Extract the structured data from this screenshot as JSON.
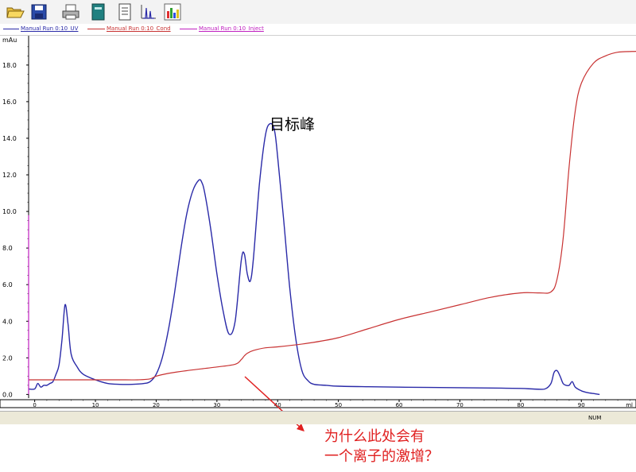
{
  "toolbar": {
    "icons": [
      "open-folder-icon",
      "save-icon",
      "print-icon",
      "notebook-icon",
      "document-icon",
      "peak-chromatogram-icon",
      "bar-chart-icon"
    ]
  },
  "legend": {
    "items": [
      {
        "label": "Manual Run 0:10_UV",
        "color": "#2a2aa8"
      },
      {
        "label": "Manual Run 0:10_Cond",
        "color": "#c83232"
      },
      {
        "label": "Manual Run 0:10_Inject",
        "color": "#c020c0"
      }
    ]
  },
  "chart_data": {
    "type": "line",
    "y_unit_label": "mAu",
    "x_unit_label": "ml",
    "xlim": [
      -1,
      99
    ],
    "ylim": [
      -0.2,
      19.6
    ],
    "x_ticks": [
      0,
      10,
      20,
      30,
      40,
      50,
      60,
      70,
      80,
      90
    ],
    "y_ticks": [
      0.0,
      2.0,
      4.0,
      6.0,
      8.0,
      10.0,
      12.0,
      14.0,
      16.0,
      18.0
    ],
    "y_tick_labels": [
      "0.0",
      "2.0",
      "4.0",
      "6.0",
      "8.0",
      "10.0",
      "12.0",
      "14.0",
      "16.0",
      "18.0"
    ],
    "grid": false,
    "series": [
      {
        "name": "Manual Run 0:10_UV",
        "color": "#2a2aa8",
        "x": [
          -1,
          0,
          0.5,
          1,
          1.5,
          2,
          2.5,
          3,
          3.5,
          4,
          4.5,
          5,
          5.5,
          6,
          7,
          8,
          10,
          12,
          14,
          16,
          18,
          19,
          20,
          21,
          22,
          23,
          24,
          25,
          26,
          27,
          27.5,
          28,
          29,
          30,
          31,
          32,
          33,
          34,
          34.5,
          35,
          35.5,
          36,
          37,
          38,
          38.8,
          39.5,
          40,
          41,
          42,
          43,
          44,
          45,
          46,
          48,
          50,
          55,
          60,
          65,
          70,
          75,
          80,
          82,
          84,
          85,
          85.5,
          86,
          86.5,
          87,
          87.5,
          88,
          88.5,
          89,
          90,
          91,
          92,
          93
        ],
        "y": [
          0.3,
          0.3,
          0.6,
          0.4,
          0.5,
          0.5,
          0.6,
          0.7,
          1.1,
          1.6,
          3.0,
          4.9,
          3.8,
          2.2,
          1.5,
          1.1,
          0.8,
          0.6,
          0.55,
          0.55,
          0.6,
          0.7,
          1.1,
          2.0,
          3.5,
          5.5,
          7.8,
          9.8,
          11.1,
          11.7,
          11.6,
          11.0,
          9.0,
          6.6,
          4.6,
          3.3,
          4.0,
          7.3,
          7.7,
          6.6,
          6.2,
          7.4,
          11.5,
          14.2,
          14.8,
          14.4,
          13.0,
          9.5,
          5.8,
          3.0,
          1.3,
          0.75,
          0.55,
          0.5,
          0.45,
          0.42,
          0.4,
          0.38,
          0.37,
          0.35,
          0.33,
          0.3,
          0.3,
          0.6,
          1.2,
          1.3,
          1.0,
          0.6,
          0.5,
          0.5,
          0.7,
          0.4,
          0.2,
          0.1,
          0.05,
          0.0
        ]
      },
      {
        "name": "Manual Run 0:10_Cond",
        "color": "#c83232",
        "x": [
          -1,
          0,
          4,
          10,
          15,
          17,
          19,
          20,
          22,
          25,
          30,
          33,
          34,
          34.5,
          35,
          36,
          38,
          40,
          45,
          50,
          55,
          60,
          65,
          70,
          75,
          80,
          83,
          85,
          86,
          87,
          88,
          89,
          90,
          92,
          94,
          96,
          99
        ],
        "y": [
          0.8,
          0.8,
          0.8,
          0.8,
          0.8,
          0.8,
          0.85,
          1.0,
          1.15,
          1.3,
          1.5,
          1.65,
          1.9,
          2.1,
          2.25,
          2.4,
          2.55,
          2.6,
          2.8,
          3.1,
          3.6,
          4.1,
          4.5,
          4.9,
          5.3,
          5.55,
          5.55,
          5.6,
          6.3,
          8.5,
          12.5,
          15.5,
          17.0,
          18.1,
          18.5,
          18.7,
          18.75
        ]
      },
      {
        "name": "Manual Run 0:10_Inject",
        "color": "#c020c0",
        "x": [
          -1,
          -1
        ],
        "y": [
          0,
          9.8
        ]
      }
    ]
  },
  "annotations": {
    "target_peak": "目标峰",
    "question_line1": "为什么此处会有",
    "question_line2": "一个离子的激增？"
  },
  "status_bar": {
    "text": "NUM"
  }
}
